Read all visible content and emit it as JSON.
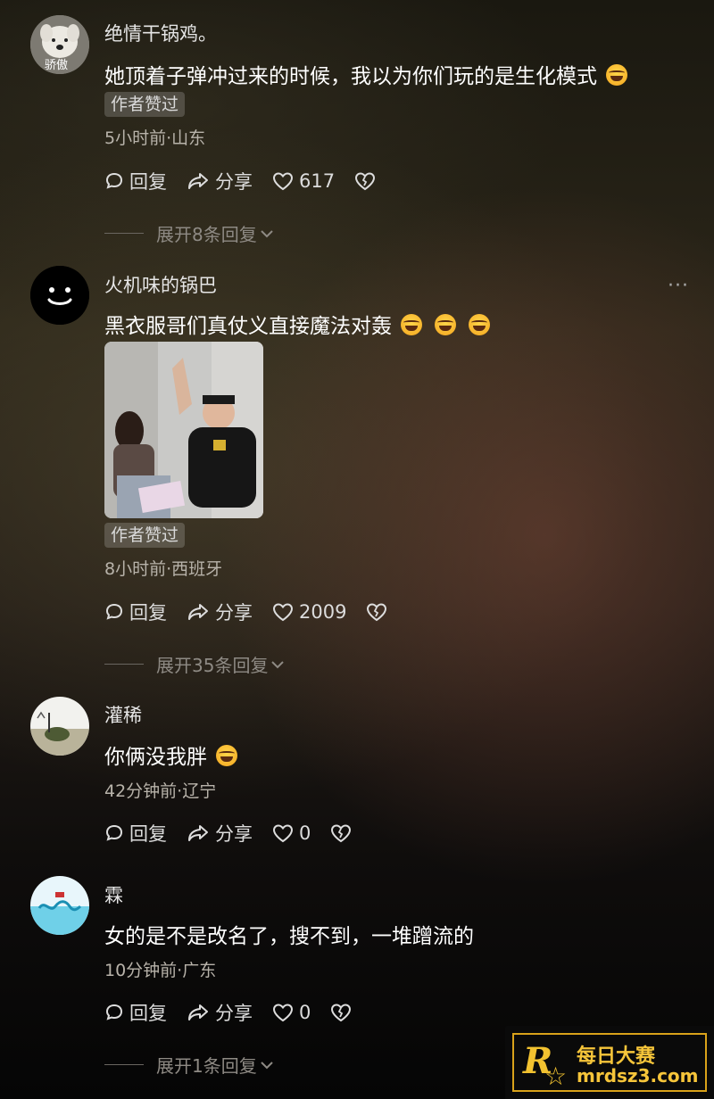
{
  "comments": [
    {
      "username": "绝情干锅鸡。",
      "text": "她顶着子弹冲过来的时候，我以为你们玩的是生化模式",
      "author_liked": "作者赞过",
      "meta": "5小时前·山东",
      "reply_label": "回复",
      "share_label": "分享",
      "likes": "617",
      "expand": "展开8条回复",
      "avatar_text": "骄傲"
    },
    {
      "username": "火机味的锅巴",
      "text": "黑衣服哥们真仗义直接魔法对轰",
      "author_liked": "作者赞过",
      "meta": "8小时前·西班牙",
      "reply_label": "回复",
      "share_label": "分享",
      "likes": "2009",
      "expand": "展开35条回复",
      "more": "···"
    },
    {
      "username": "灌稀",
      "text": "你俩没我胖",
      "meta": "42分钟前·辽宁",
      "reply_label": "回复",
      "share_label": "分享",
      "likes": "0"
    },
    {
      "username": "霖",
      "text": "女的是不是改名了，搜不到，一堆蹭流的",
      "meta": "10分钟前·广东",
      "reply_label": "回复",
      "share_label": "分享",
      "likes": "0",
      "expand": "展开1条回复"
    }
  ],
  "watermark": {
    "logo_letter": "R",
    "brand_cn": "每日大赛",
    "url": "mrdsz3.com"
  },
  "colors": {
    "badge_bg": "#3a3630",
    "watermark_gold": "#f2c230"
  }
}
